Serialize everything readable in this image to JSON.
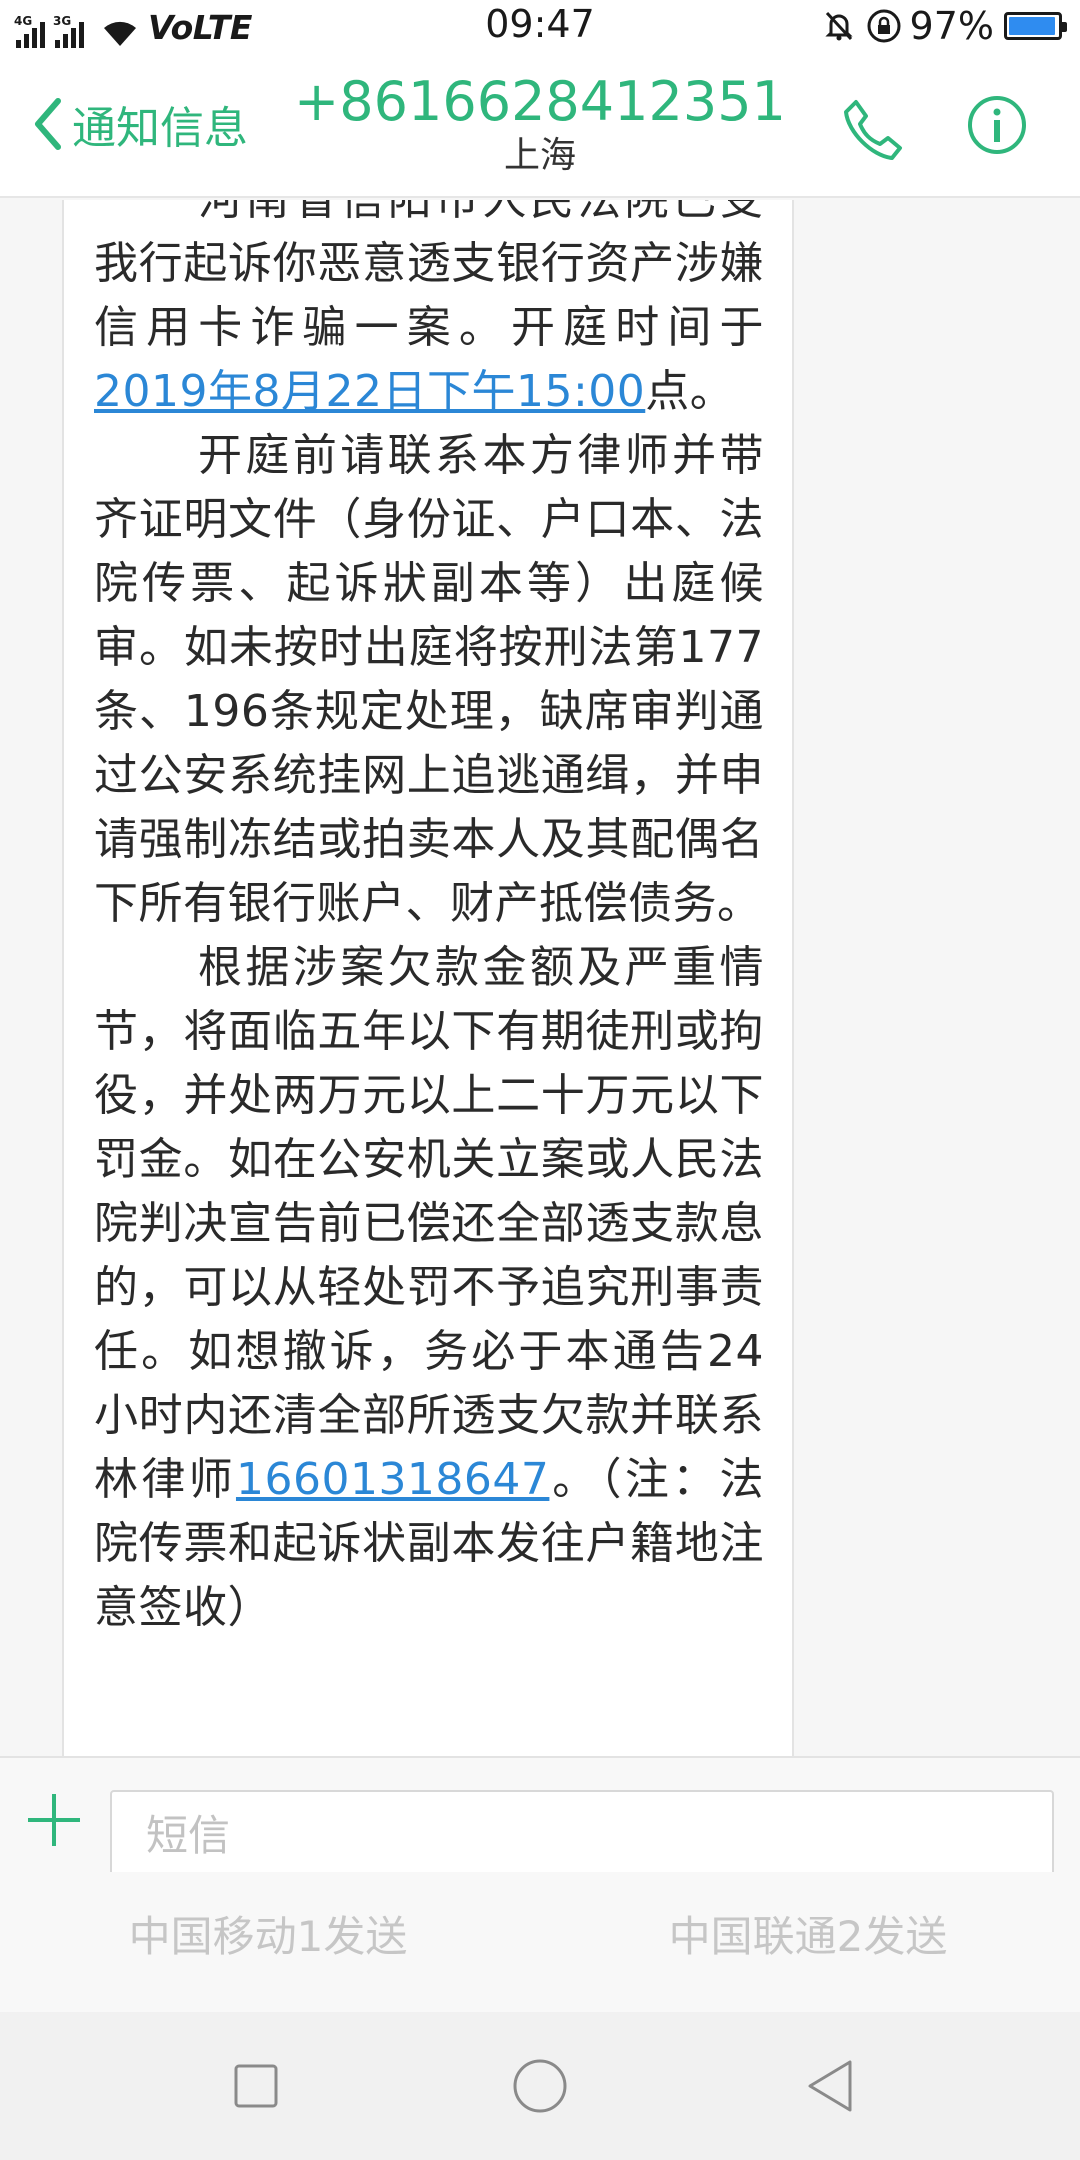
{
  "status_bar": {
    "sim1_tag": "4G",
    "sim2_tag": "3G",
    "volte": "VoLTE",
    "time": "09:47",
    "battery_percent": "97%",
    "battery_level": 0.97
  },
  "header": {
    "back_label": "通知信息",
    "contact_number": "+8616628412351",
    "contact_location": "上海"
  },
  "message": {
    "line_partial": "河南省信阳市人民法院已受理",
    "p1_text": "我行起诉你恶意透支银行资产涉嫌信用卡诈骗一案。开庭时间于",
    "p1_link_date": "2019年8月22日下午15:00",
    "p1_tail": "点。",
    "p2_text": "开庭前请联系本方律师并带齐证明文件（身份证、户口本、法院传票、起诉狀副本等）出庭候审。如未按时出庭将按刑法第177条、196条规定处理，缺席审判通过公安系统挂网上追逃通缉，并申请强制冻结或拍卖本人及其配偶名下所有银行账户、财产抵偿债务。",
    "p3_text": "根据涉案欠款金额及严重情节，将面临五年以下有期徒刑或拘役，并处两万元以上二十万元以下罚金。如在公安机关立案或人民法院判决宣告前已偿还全部透支款息的，可以从轻处罚不予追究刑事责任。如想撤诉，务必于本通告24小时内还清全部所透支欠款并联系林律师",
    "p3_link_phone": "16601318647",
    "p3_tail": "。（注：法院传票和起诉状副本发往户籍地注意签收）"
  },
  "composer": {
    "placeholder": "短信",
    "send_sim1": "中国移动1发送",
    "send_sim2": "中国联通2发送"
  },
  "colors": {
    "accent": "#2fb67c",
    "link": "#2b87d6"
  }
}
